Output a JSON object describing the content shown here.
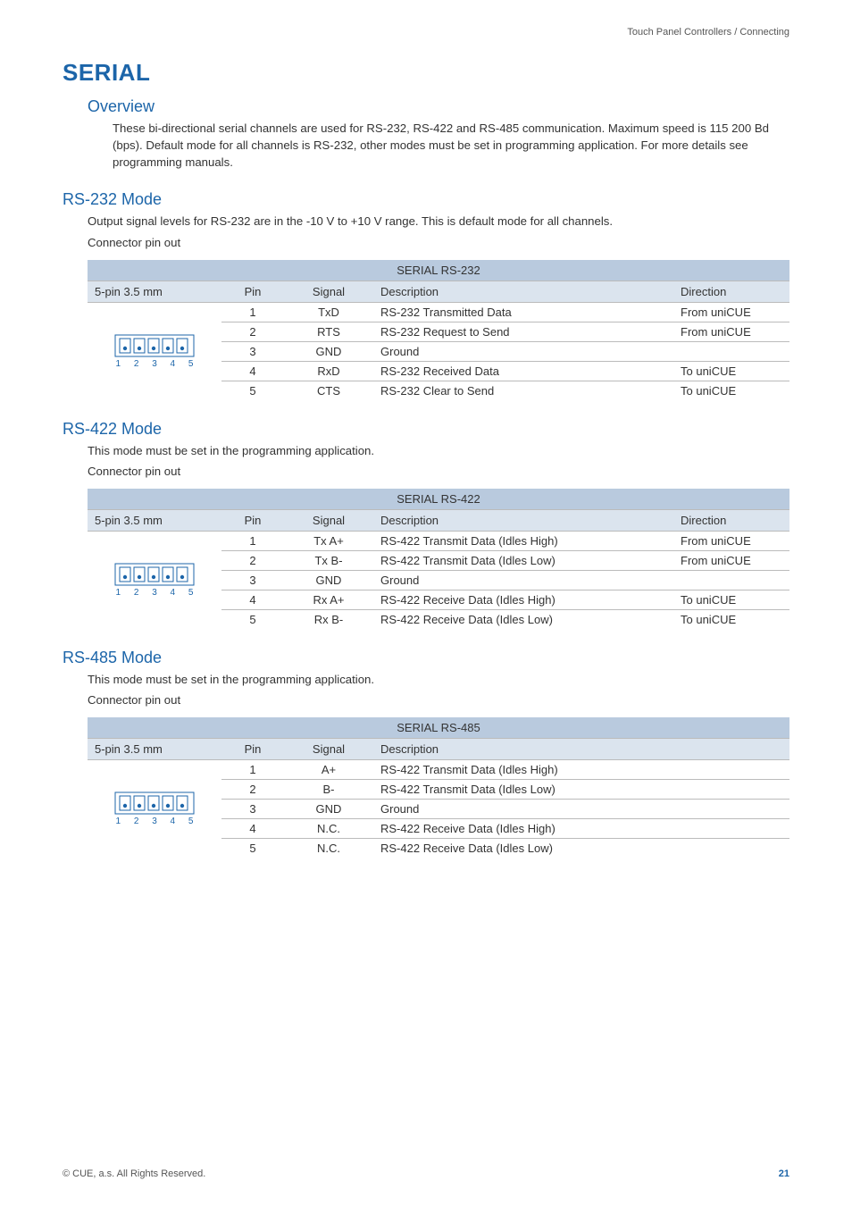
{
  "header": "Touch Panel Controllers / Connecting",
  "title": "SERIAL",
  "overview": {
    "heading": "Overview",
    "text": "These bi-directional serial channels are used for RS-232, RS-422 and RS-485 communication. Maximum speed is 115 200 Bd (bps). Default mode for all channels is RS-232, other modes must be set in programming application. For more details see programming manuals."
  },
  "rs232": {
    "heading": "RS-232 Mode",
    "desc": "Output signal levels for RS-232 are in the -10 V to +10 V range. This is default mode for all channels.",
    "sub": "Connector pin out",
    "table_title": "SERIAL RS-232",
    "cols": {
      "c1": "5-pin 3.5 mm",
      "c2": "Pin",
      "c3": "Signal",
      "c4": "Description",
      "c5": "Direction"
    },
    "rows": [
      {
        "pin": "1",
        "signal": "TxD",
        "desc": "RS-232 Transmitted Data",
        "dir": "From uniCUE"
      },
      {
        "pin": "2",
        "signal": "RTS",
        "desc": "RS-232 Request to Send",
        "dir": "From uniCUE"
      },
      {
        "pin": "3",
        "signal": "GND",
        "desc": "Ground",
        "dir": ""
      },
      {
        "pin": "4",
        "signal": "RxD",
        "desc": "RS-232 Received Data",
        "dir": "To uniCUE"
      },
      {
        "pin": "5",
        "signal": "CTS",
        "desc": "RS-232 Clear to Send",
        "dir": "To uniCUE"
      }
    ],
    "pin_label": "1  2  3  4  5"
  },
  "rs422": {
    "heading": "RS-422 Mode",
    "desc": "This mode must be set in the programming application.",
    "sub": "Connector pin out",
    "table_title": "SERIAL RS-422",
    "cols": {
      "c1": "5-pin 3.5 mm",
      "c2": "Pin",
      "c3": "Signal",
      "c4": "Description",
      "c5": "Direction"
    },
    "rows": [
      {
        "pin": "1",
        "signal": "Tx A+",
        "desc": "RS-422 Transmit Data (Idles High)",
        "dir": "From uniCUE"
      },
      {
        "pin": "2",
        "signal": "Tx B-",
        "desc": "RS-422 Transmit Data (Idles Low)",
        "dir": "From uniCUE"
      },
      {
        "pin": "3",
        "signal": "GND",
        "desc": "Ground",
        "dir": ""
      },
      {
        "pin": "4",
        "signal": "Rx A+",
        "desc": "RS-422 Receive Data (Idles High)",
        "dir": "To uniCUE"
      },
      {
        "pin": "5",
        "signal": "Rx B-",
        "desc": "RS-422 Receive Data (Idles Low)",
        "dir": "To uniCUE"
      }
    ],
    "pin_label": "1  2  3  4  5"
  },
  "rs485": {
    "heading": "RS-485 Mode",
    "desc": "This mode must be set in the programming application.",
    "sub": "Connector pin out",
    "table_title": "SERIAL RS-485",
    "cols": {
      "c1": "5-pin 3.5 mm",
      "c2": "Pin",
      "c3": "Signal",
      "c4": "Description"
    },
    "rows": [
      {
        "pin": "1",
        "signal": "A+",
        "desc": "RS-422 Transmit Data (Idles High)"
      },
      {
        "pin": "2",
        "signal": "B-",
        "desc": "RS-422 Transmit Data (Idles Low)"
      },
      {
        "pin": "3",
        "signal": "GND",
        "desc": "Ground"
      },
      {
        "pin": "4",
        "signal": "N.C.",
        "desc": "RS-422 Receive Data (Idles High)"
      },
      {
        "pin": "5",
        "signal": "N.C.",
        "desc": "RS-422 Receive Data (Idles Low)"
      }
    ],
    "pin_label": "1  2  3  4  5"
  },
  "footer": {
    "copyright": "© CUE, a.s. All Rights Reserved.",
    "page": "21"
  }
}
